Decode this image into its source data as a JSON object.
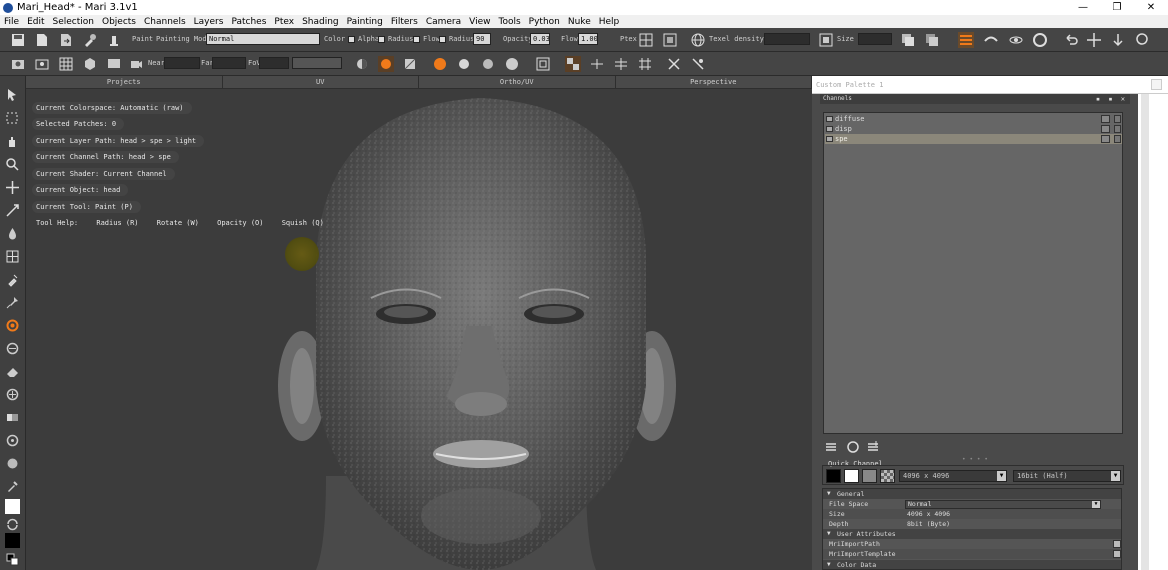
{
  "window": {
    "title": "Mari_Head* - Mari 3.1v1",
    "controls": [
      "—",
      "❐",
      "✕"
    ]
  },
  "menu": [
    "File",
    "Edit",
    "Selection",
    "Objects",
    "Channels",
    "Layers",
    "Patches",
    "Ptex",
    "Shading",
    "Painting",
    "Filters",
    "Camera",
    "View",
    "Tools",
    "Python",
    "Nuke",
    "Help"
  ],
  "toolbar1": {
    "paint_label": "Paint",
    "painting_mode_label": "Painting Mode",
    "painting_mode_value": "Normal",
    "color_label": "Color",
    "alpha_label": "Alpha",
    "radius_check_label": "Radius",
    "flow_check_label": "Flow",
    "radius_label": "Radius",
    "radius_value": "90",
    "opacity_label": "Opacity",
    "opacity_value": "0.03",
    "flow_label": "Flow",
    "flow_value": "1.00",
    "ptex_label": "Ptex",
    "texel_density_label": "Texel density :",
    "texel_density_value": "",
    "size_label": "Size :",
    "size_value": ""
  },
  "toolbar2": {
    "near_label": "Near",
    "far_label": "Far",
    "fov_label": "FoV"
  },
  "viewport": {
    "tabs": [
      "Projects",
      "UV",
      "Ortho/UV",
      "Perspective"
    ],
    "info": [
      "Current Colorspace: Automatic (raw)",
      "Selected Patches: 0",
      "Current Layer Path: head > spe > light",
      "Current Channel Path: head > spe",
      "Current Shader: Current Channel",
      "Current Object: head",
      "Current Tool: Paint (P)"
    ],
    "tool_help_label": "Tool Help:",
    "tool_help": [
      "Radius (R)",
      "Rotate (W)",
      "Opacity (O)",
      "Squish (Q)"
    ]
  },
  "palette": {
    "title": "Custom Palette 1",
    "channels_header": "Channels",
    "channels": [
      {
        "name": "diffuse",
        "selected": false
      },
      {
        "name": "disp",
        "selected": false
      },
      {
        "name": "spe",
        "selected": true
      }
    ],
    "quick_channel_title": "Quick Channel",
    "quick_channel_size": "4096 x 4096",
    "quick_channel_depth": "16bit (Half)",
    "sections": {
      "general": "General",
      "user_attributes": "User Attributes",
      "color_data": "Color Data"
    },
    "props": [
      {
        "key": "File Space",
        "value": "Normal"
      },
      {
        "key": "Size",
        "value": "4096 x 4096"
      },
      {
        "key": "Depth",
        "value": "8bit (Byte)"
      }
    ],
    "user_attrs": [
      "MriImportPath",
      "MriImportTemplate"
    ]
  },
  "colors": {
    "accent_orange": "#f07a1a",
    "selected_row": "#8b877a",
    "panel_bg": "#4a4a4a"
  }
}
